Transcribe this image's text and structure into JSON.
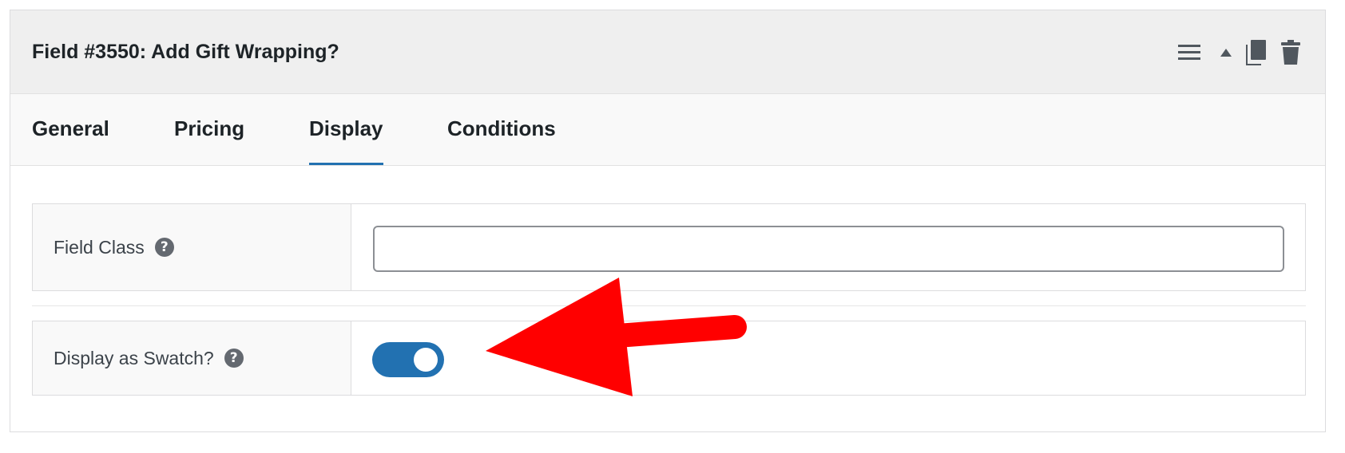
{
  "header": {
    "title": "Field #3550: Add Gift Wrapping?",
    "icons": [
      "menu-icon",
      "collapse-arrow-icon",
      "duplicate-icon",
      "trash-icon"
    ]
  },
  "tabs": [
    {
      "label": "General",
      "active": false
    },
    {
      "label": "Pricing",
      "active": false
    },
    {
      "label": "Display",
      "active": true
    },
    {
      "label": "Conditions",
      "active": false
    }
  ],
  "fields": {
    "field_class": {
      "label": "Field Class",
      "value": "",
      "help": "?"
    },
    "display_swatch": {
      "label": "Display as Swatch?",
      "enabled": true,
      "help": "?"
    }
  },
  "annotation": {
    "type": "arrow",
    "color": "#ff0000"
  },
  "colors": {
    "accent": "#2271b1",
    "header_bg": "#efefef",
    "tabs_bg": "#f9f9f9",
    "text": "#1d2327",
    "annotation": "#ff0000"
  }
}
